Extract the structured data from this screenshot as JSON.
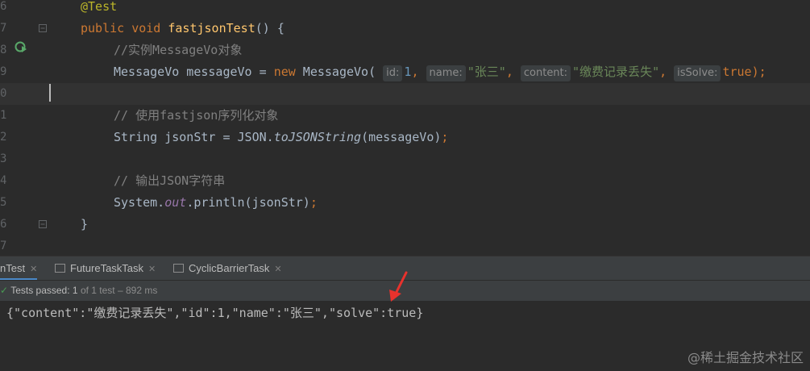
{
  "editor": {
    "lines": [
      {
        "num": "6",
        "text": "@Test"
      },
      {
        "num": "7",
        "text": "public void fastjsonTest() {"
      },
      {
        "num": "8",
        "text": "//实例MessageVo对象"
      },
      {
        "num": "9",
        "text": "MessageVo messageVo = new MessageVo( id: 1, name: \"张三\", content: \"缴费记录丢失\", isSolve: true);"
      },
      {
        "num": "0",
        "text": ""
      },
      {
        "num": "1",
        "text": "// 使用fastjson序列化对象"
      },
      {
        "num": "2",
        "text": "String jsonStr = JSON.toJSONString(messageVo);"
      },
      {
        "num": "3",
        "text": ""
      },
      {
        "num": "4",
        "text": "// 输出JSON字符串"
      },
      {
        "num": "5",
        "text": "System.out.println(jsonStr);"
      },
      {
        "num": "6",
        "text": "}"
      },
      {
        "num": "7",
        "text": ""
      }
    ],
    "tokens": {
      "at_test": "@Test",
      "public": "public",
      "void": "void",
      "method_name": "fastjsonTest",
      "method_tail": "() {",
      "comment1": "//实例MessageVo对象",
      "l9_type": "MessageVo messageVo = ",
      "l9_new": "new",
      "l9_ctor": " MessageVo(",
      "hint_id": "id:",
      "val_id": "1",
      "hint_name": "name:",
      "val_name": "\"张三\"",
      "hint_content": "content:",
      "val_content": "\"缴费记录丢失\"",
      "hint_issolve": "isSolve:",
      "val_issolve": "true",
      "l9_end": ");",
      "comment2": "// 使用fastjson序列化对象",
      "l12_start": "String jsonStr = JSON.",
      "l12_method": "toJSONString",
      "l12_arg": "(messageVo)",
      "semicolon": ";",
      "comment3": "// 输出JSON字符串",
      "l15_sys": "System.",
      "l15_out": "out",
      "l15_rest": ".println(jsonStr)",
      "close_brace": "}",
      "comma": ","
    }
  },
  "tabs": [
    {
      "label": "nTest",
      "active": true
    },
    {
      "label": "FutureTaskTask",
      "active": false
    },
    {
      "label": "CyclicBarrierTask",
      "active": false
    }
  ],
  "status": {
    "label": "Tests passed:",
    "passed": "1",
    "detail": "of 1 test – 892 ms"
  },
  "console": {
    "output": "{\"content\":\"缴费记录丢失\",\"id\":1,\"name\":\"张三\",\"solve\":true}"
  },
  "watermark": "@稀土掘金技术社区",
  "colors": {
    "editor_bg": "#2b2b2b",
    "keyword": "#cc7832",
    "annotation": "#bbb529",
    "string": "#6a8759",
    "comment": "#808080",
    "arrow": "#e8322d",
    "pass": "#499c54"
  }
}
